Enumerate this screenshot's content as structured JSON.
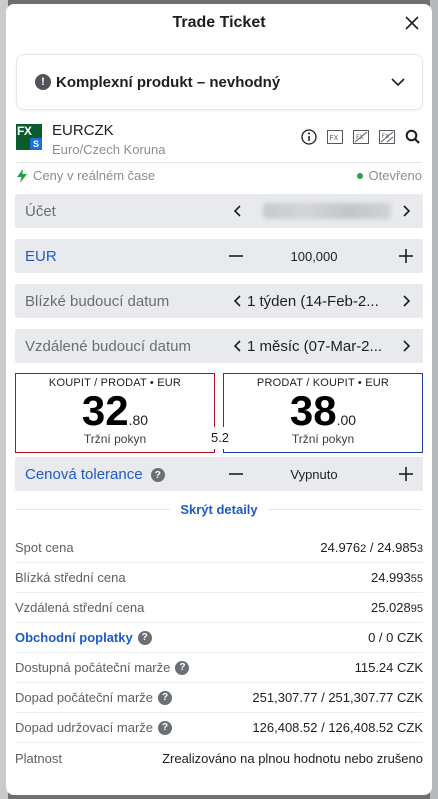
{
  "window": {
    "title": "Trade Ticket"
  },
  "warning": {
    "label": "Komplexní produkt – nevhodný"
  },
  "instrument": {
    "symbol": "EURCZK",
    "description": "Euro/Czech Koruna",
    "logo_text": "FX",
    "logo_badge": "S"
  },
  "status": {
    "price_mode": "Ceny v reálném čase",
    "market": "Otevřeno"
  },
  "account": {
    "label": "Účet"
  },
  "amount": {
    "currency": "EUR",
    "value": "100,000"
  },
  "near_date": {
    "label": "Blízké budoucí datum",
    "value": "1 týden (14-Feb-2..."
  },
  "far_date": {
    "label": "Vzdálené budoucí datum",
    "value": "1 měsíc (07-Mar-2..."
  },
  "buy": {
    "header": "KOUPIT / PRODAT • EUR",
    "big": "32",
    "small": ".80",
    "order_type": "Tržní pokyn"
  },
  "sell": {
    "header": "PRODAT / KOUPIT • EUR",
    "big": "38",
    "small": ".00",
    "order_type": "Tržní pokyn"
  },
  "spread": "5.2",
  "tolerance": {
    "label": "Cenová tolerance",
    "value": "Vypnuto"
  },
  "details_toggle": "Skrýt detaily",
  "details": {
    "spot": {
      "label": "Spot cena",
      "value_main": "24.976",
      "value_sub": "2",
      "value_main2": " / 24.985",
      "value_sub2": "3"
    },
    "near_mid": {
      "label": "Blízká střední cena",
      "value_main": "24.993",
      "value_sub": "55"
    },
    "far_mid": {
      "label": "Vzdálená střední cena",
      "value_main": "25.028",
      "value_sub": "95"
    },
    "fees": {
      "label": "Obchodní poplatky",
      "value": "0 / 0 CZK"
    },
    "avail_margin": {
      "label": "Dostupná počáteční marže",
      "value": "115.24 CZK"
    },
    "init_margin": {
      "label": "Dopad počáteční marže",
      "value": "251,307.77 / 251,307.77 CZK"
    },
    "maint_margin": {
      "label": "Dopad udržovací marže",
      "value": "126,408.52 / 126,408.52 CZK"
    },
    "validity": {
      "label": "Platnost",
      "value": "Zrealizováno na plnou hodnotu nebo zrušeno"
    }
  },
  "icons": {
    "question": "?",
    "warning": "!"
  }
}
